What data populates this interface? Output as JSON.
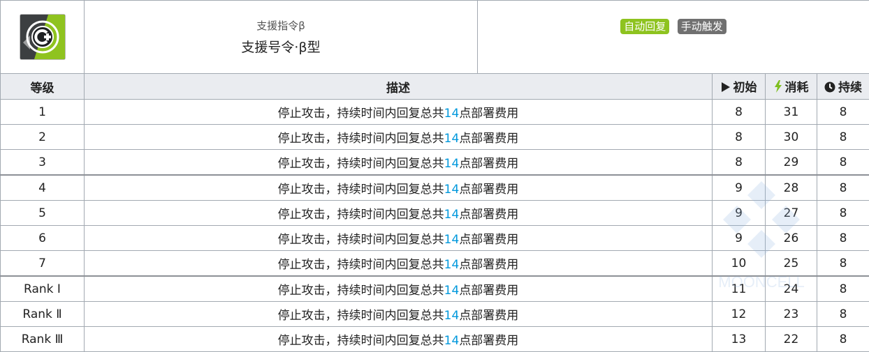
{
  "skill": {
    "icon": "support-command-icon",
    "subtitle": "支援指令β",
    "name": "支援号令·β型",
    "badges": [
      {
        "label": "自动回复",
        "color": "#8ec31f"
      },
      {
        "label": "手动触发",
        "color": "#707070"
      }
    ]
  },
  "header": {
    "level": "等级",
    "desc": "描述",
    "initial": "初始",
    "cost": "消耗",
    "duration": "持续"
  },
  "rows": [
    {
      "level": "1",
      "desc_pre": "停止攻击，持续时间内回复总共",
      "desc_num": "14",
      "desc_post": "点部署费用",
      "initial": "8",
      "cost": "31",
      "duration": "8"
    },
    {
      "level": "2",
      "desc_pre": "停止攻击，持续时间内回复总共",
      "desc_num": "14",
      "desc_post": "点部署费用",
      "initial": "8",
      "cost": "30",
      "duration": "8"
    },
    {
      "level": "3",
      "desc_pre": "停止攻击，持续时间内回复总共",
      "desc_num": "14",
      "desc_post": "点部署费用",
      "initial": "8",
      "cost": "29",
      "duration": "8"
    },
    {
      "level": "4",
      "desc_pre": "停止攻击，持续时间内回复总共",
      "desc_num": "14",
      "desc_post": "点部署费用",
      "initial": "9",
      "cost": "28",
      "duration": "8"
    },
    {
      "level": "5",
      "desc_pre": "停止攻击，持续时间内回复总共",
      "desc_num": "14",
      "desc_post": "点部署费用",
      "initial": "9",
      "cost": "27",
      "duration": "8"
    },
    {
      "level": "6",
      "desc_pre": "停止攻击，持续时间内回复总共",
      "desc_num": "14",
      "desc_post": "点部署费用",
      "initial": "9",
      "cost": "26",
      "duration": "8"
    },
    {
      "level": "7",
      "desc_pre": "停止攻击，持续时间内回复总共",
      "desc_num": "14",
      "desc_post": "点部署费用",
      "initial": "10",
      "cost": "25",
      "duration": "8"
    },
    {
      "level": "Rank Ⅰ",
      "desc_pre": "停止攻击，持续时间内回复总共",
      "desc_num": "14",
      "desc_post": "点部署费用",
      "initial": "11",
      "cost": "24",
      "duration": "8"
    },
    {
      "level": "Rank Ⅱ",
      "desc_pre": "停止攻击，持续时间内回复总共",
      "desc_num": "14",
      "desc_post": "点部署费用",
      "initial": "12",
      "cost": "23",
      "duration": "8"
    },
    {
      "level": "Rank Ⅲ",
      "desc_pre": "停止攻击，持续时间内回复总共",
      "desc_num": "14",
      "desc_post": "点部署费用",
      "initial": "13",
      "cost": "22",
      "duration": "8"
    }
  ],
  "colors": {
    "highlight": "#0098dc",
    "header_bg": "#eaecf0",
    "border": "#a2a9b1",
    "cost_icon": "#7fbf1f"
  },
  "watermark": "MOONCELL"
}
